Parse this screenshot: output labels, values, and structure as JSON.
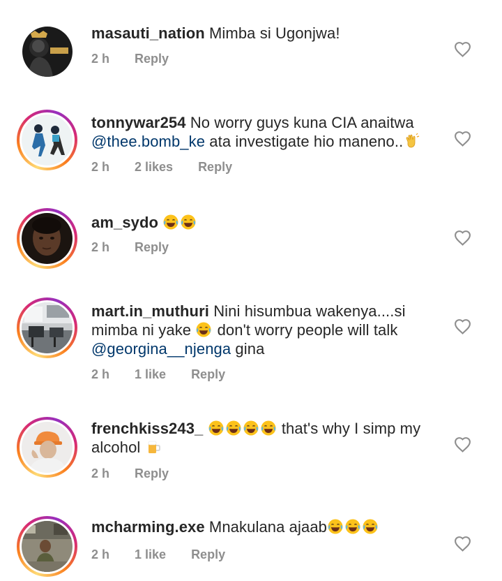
{
  "comments": [
    {
      "username": "masauti_nation",
      "segments": [
        {
          "type": "text",
          "value": "Mimba si Ugonjwa!"
        }
      ],
      "time": "2 h",
      "likes": "",
      "reply_label": "Reply",
      "avatar_ring": false
    },
    {
      "username": "tonnywar254",
      "segments": [
        {
          "type": "text",
          "value": "No worry guys kuna CIA anaitwa"
        },
        {
          "type": "mention",
          "value": "@thee.bomb_ke"
        },
        {
          "type": "text",
          "value": "ata investigate hio maneno.."
        },
        {
          "type": "emoji",
          "value": "waving-hand-emoji"
        }
      ],
      "time": "2 h",
      "likes": "2 likes",
      "reply_label": "Reply",
      "avatar_ring": true
    },
    {
      "username": "am_sydo",
      "segments": [
        {
          "type": "emoji",
          "value": "joy-emoji"
        },
        {
          "type": "emoji",
          "value": "joy-emoji"
        }
      ],
      "time": "2 h",
      "likes": "",
      "reply_label": "Reply",
      "avatar_ring": true
    },
    {
      "username": "mart.in_muthuri",
      "segments": [
        {
          "type": "text",
          "value": "Nini hisumbua wakenya....si mimba ni yake"
        },
        {
          "type": "emoji",
          "value": "joy-emoji"
        },
        {
          "type": "text",
          "value": "don't worry people will talk"
        },
        {
          "type": "mention",
          "value": "@georgina__njenga"
        },
        {
          "type": "text",
          "value": "gina"
        }
      ],
      "time": "2 h",
      "likes": "1 like",
      "reply_label": "Reply",
      "avatar_ring": true
    },
    {
      "username": "frenchkiss243_",
      "segments": [
        {
          "type": "emoji",
          "value": "joy-emoji"
        },
        {
          "type": "emoji",
          "value": "joy-emoji"
        },
        {
          "type": "emoji",
          "value": "joy-emoji"
        },
        {
          "type": "emoji",
          "value": "joy-emoji"
        },
        {
          "type": "text",
          "value": "that's why I simp my alcohol"
        },
        {
          "type": "emoji",
          "value": "beer-mug-emoji"
        }
      ],
      "time": "2 h",
      "likes": "",
      "reply_label": "Reply",
      "avatar_ring": true
    },
    {
      "username": "mcharming.exe",
      "segments": [
        {
          "type": "text",
          "value": "Mnakulana ajaab"
        },
        {
          "type": "emoji",
          "value": "joy-emoji"
        },
        {
          "type": "emoji",
          "value": "joy-emoji"
        },
        {
          "type": "emoji",
          "value": "joy-emoji"
        }
      ],
      "time": "2 h",
      "likes": "1 like",
      "reply_label": "Reply",
      "avatar_ring": true
    }
  ],
  "icons": {
    "like": "heart-outline-icon"
  },
  "colors": {
    "username": "#262626",
    "meta": "#8e8e8e",
    "mention": "#00376b",
    "heart": "#8e8e8e"
  }
}
